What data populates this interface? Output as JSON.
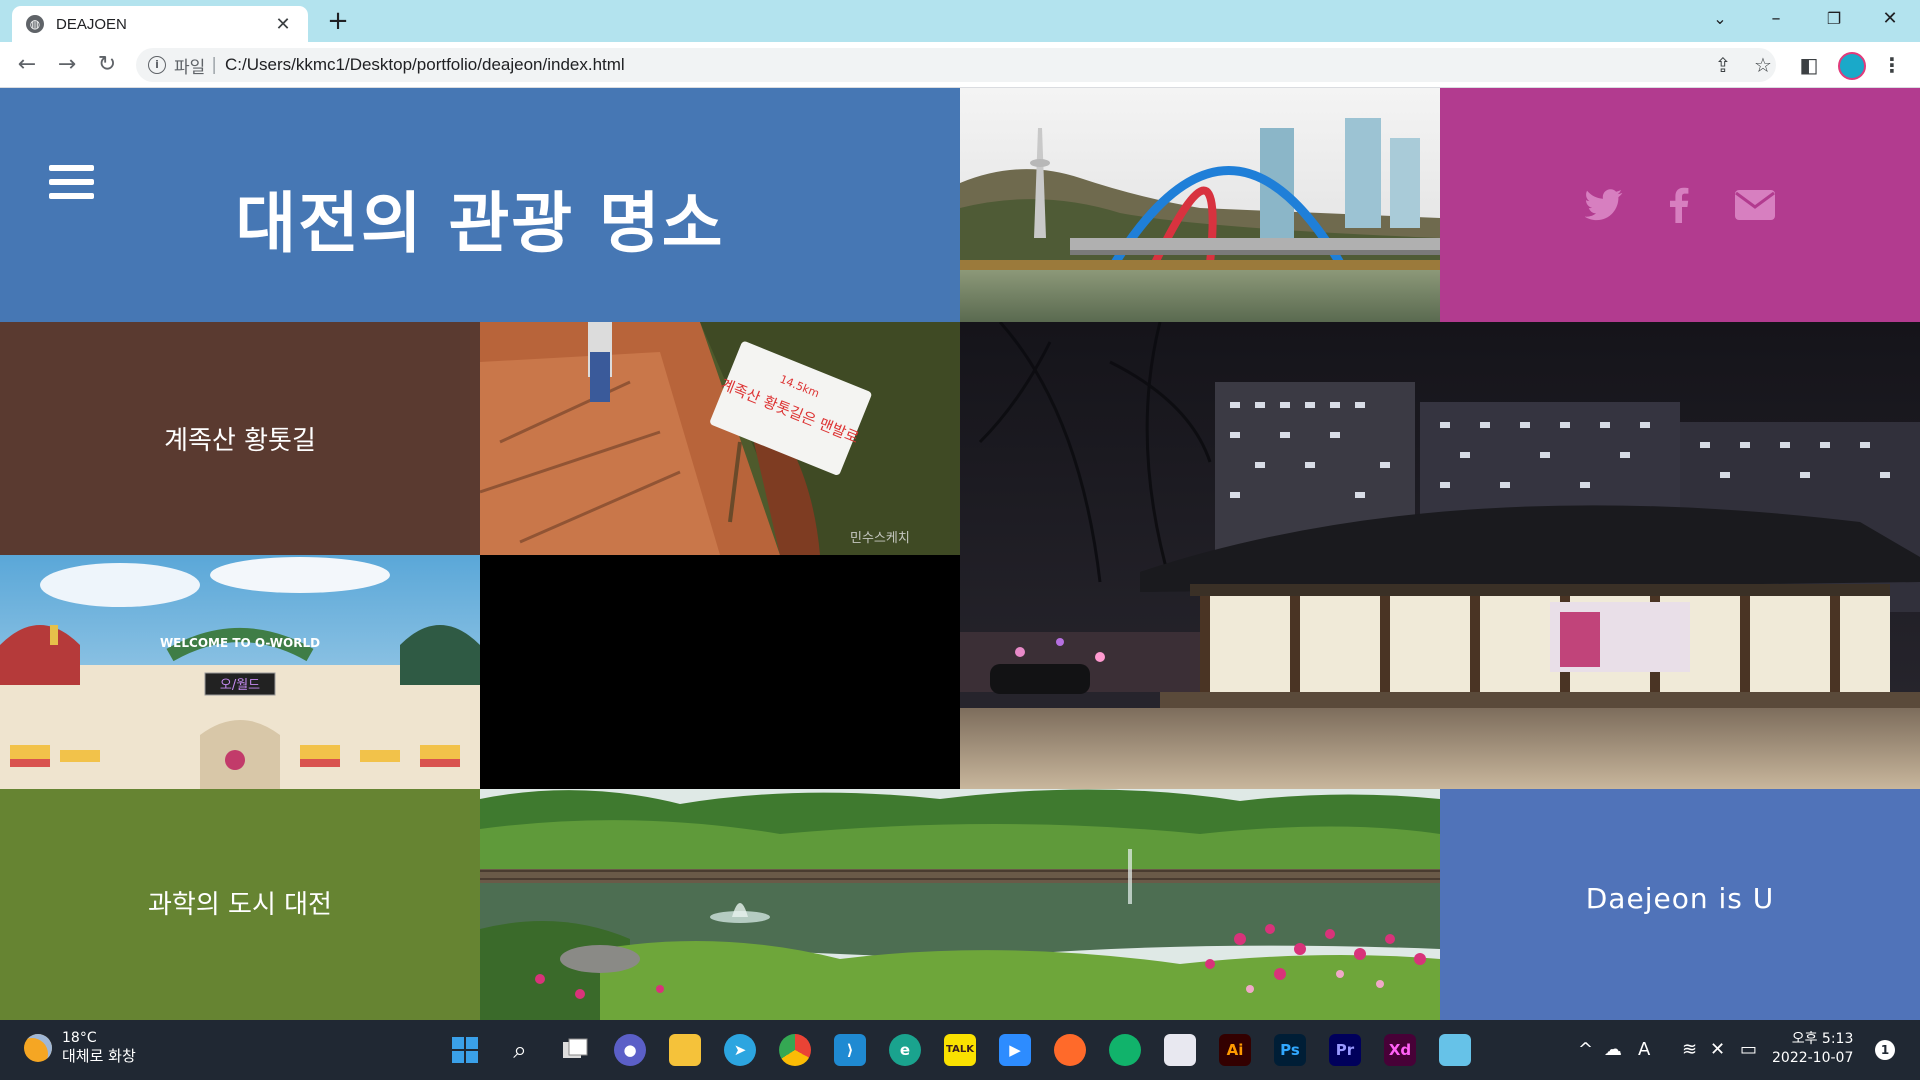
{
  "browser": {
    "tab_title": "DEAJOEN",
    "new_tab": "+",
    "scheme_label": "파일",
    "separator": "|",
    "url": "C:/Users/kkmc1/Desktop/portfolio/deajeon/index.html"
  },
  "page": {
    "title": "대전의 관광 명소",
    "tiles": {
      "trail_label": "계족산 황톳길",
      "science_label": "과학의 도시 대전",
      "slogan_label": "Daejeon is U"
    },
    "photos": {
      "trail_sign_text": "계족산 황톳길은 맨발로",
      "trail_sign_km": "14.5km",
      "trail_watermark": "민수스케치",
      "oworld_sign": "WELCOME TO O-WORLD",
      "oworld_board": "오/월드"
    },
    "social_icons": [
      "twitter-icon",
      "facebook-icon",
      "envelope-icon"
    ],
    "colors": {
      "header": "#4677b4",
      "social": "#b23b8f",
      "trail_tile": "#5a3a30",
      "science_tile": "#668432",
      "slogan_tile": "#5073b9"
    }
  },
  "taskbar": {
    "weather_temp": "18°C",
    "weather_desc": "대체로 화창",
    "clock_time": "오후 5:13",
    "clock_date": "2022-10-07",
    "notification_count": "1",
    "apps": [
      {
        "name": "start",
        "label": ""
      },
      {
        "name": "search",
        "label": ""
      },
      {
        "name": "task-view",
        "label": ""
      },
      {
        "name": "chat",
        "label": ""
      },
      {
        "name": "file-explorer",
        "label": ""
      },
      {
        "name": "telegram",
        "label": ""
      },
      {
        "name": "chrome",
        "label": ""
      },
      {
        "name": "vscode",
        "label": ""
      },
      {
        "name": "edge",
        "label": ""
      },
      {
        "name": "kakaotalk",
        "label": "TALK"
      },
      {
        "name": "zoom",
        "label": ""
      },
      {
        "name": "firefox",
        "label": ""
      },
      {
        "name": "naver-whale",
        "label": ""
      },
      {
        "name": "snipping-tool",
        "label": ""
      },
      {
        "name": "illustrator",
        "label": "Ai"
      },
      {
        "name": "photoshop",
        "label": "Ps"
      },
      {
        "name": "premiere",
        "label": "Pr"
      },
      {
        "name": "xd",
        "label": "Xd"
      },
      {
        "name": "notepad",
        "label": ""
      }
    ]
  }
}
